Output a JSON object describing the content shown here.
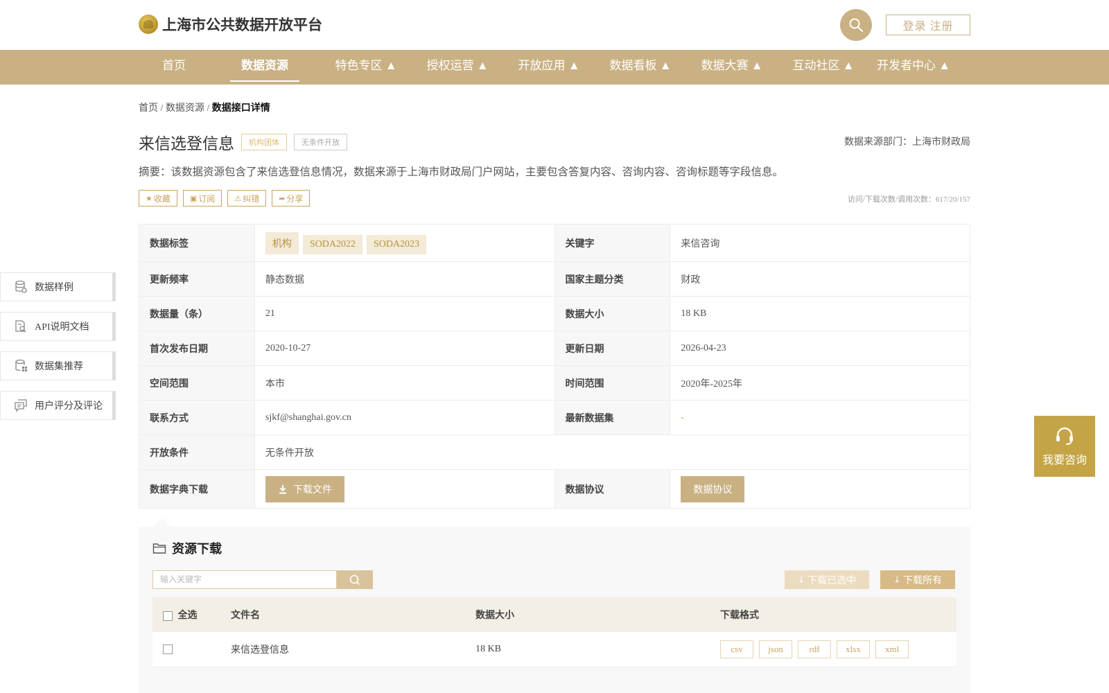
{
  "header": {
    "site_title": "上海市公共数据开放平台",
    "login_label": "登录 注册"
  },
  "nav": [
    {
      "label": "首页"
    },
    {
      "label": "数据资源"
    },
    {
      "label": "特色专区 ▲"
    },
    {
      "label": "授权运营 ▲"
    },
    {
      "label": "开放应用 ▲"
    },
    {
      "label": "数据看板 ▲"
    },
    {
      "label": "数据大赛 ▲"
    },
    {
      "label": "互动社区 ▲"
    },
    {
      "label": "开发者中心 ▲"
    }
  ],
  "breadcrumb": {
    "home": "首页",
    "sep1": " / ",
    "resources": "数据资源",
    "sep2": " / ",
    "current": "数据接口详情"
  },
  "dataset": {
    "title": "来信选登信息",
    "tag_org": "机构团体",
    "tag_open": "无条件开放",
    "source_dept": "数据来源部门：上海市财政局",
    "summary": "摘要：该数据资源包含了来信选登信息情况，数据来源于上海市财政局门户网站，主要包含答复内容、咨询内容、咨询标题等字段信息。",
    "stats": "访问/下载次数/调用次数：617/20/157"
  },
  "actions": {
    "favorite": "收藏",
    "subscribe": "订阅",
    "report": "纠错",
    "share": "分享"
  },
  "info": {
    "tags_label": "数据标签",
    "tags": [
      "机构",
      "SODA2022",
      "SODA2023"
    ],
    "keyword_label": "关键字",
    "keyword": "来信咨询",
    "freq_label": "更新频率",
    "freq": "静态数据",
    "category_label": "国家主题分类",
    "category": "财政",
    "count_label": "数据量（条）",
    "count": "21",
    "size_label": "数据大小",
    "size": "18 KB",
    "first_pub_label": "首次发布日期",
    "first_pub": "2020-10-27",
    "update_label": "更新日期",
    "update": "2026-04-23",
    "space_label": "空间范围",
    "space": "本市",
    "time_label": "时间范围",
    "time": "2020年-2025年",
    "contact_label": "联系方式",
    "contact": "sjkf@shanghai.gov.cn",
    "latest_label": "最新数据集",
    "latest": "-",
    "open_label": "开放条件",
    "open": "无条件开放",
    "dict_label": "数据字典下载",
    "dict_btn": "下载文件",
    "agreement_label": "数据协议",
    "agreement_btn": "数据协议"
  },
  "side_nav": [
    {
      "label": "数据样例"
    },
    {
      "label": "API说明文档"
    },
    {
      "label": "数据集推荐"
    },
    {
      "label": "用户评分及评论"
    }
  ],
  "consult": {
    "label": "我要咨询"
  },
  "resources": {
    "title": "资源下载",
    "search_placeholder": "输入关键字",
    "download_selected": "下载已选中",
    "download_all": "下载所有",
    "col_select_all": "全选",
    "col_filename": "文件名",
    "col_size": "数据大小",
    "col_format": "下载格式",
    "rows": [
      {
        "filename": "来信选登信息",
        "size": "18 KB",
        "formats": [
          "csv",
          "json",
          "rdf",
          "xlsx",
          "xml"
        ]
      }
    ]
  },
  "colors": {
    "brand": "#c9b183",
    "accent": "#c4a447",
    "chip_bg": "#f3ead7"
  }
}
